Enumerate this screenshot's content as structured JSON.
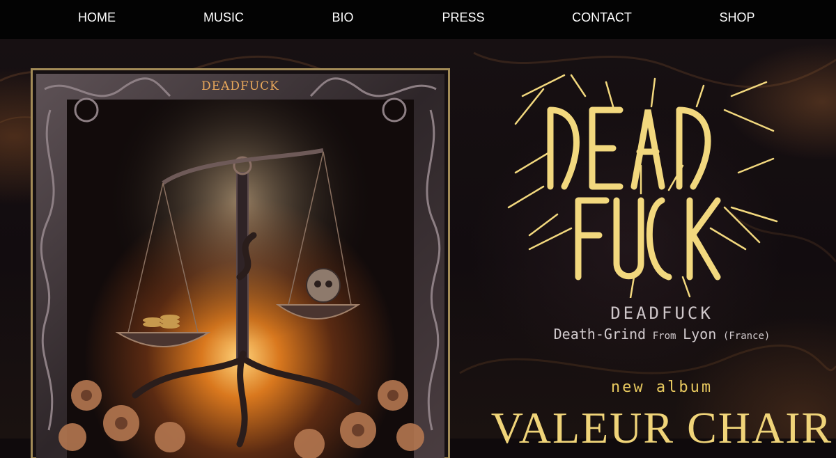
{
  "nav": {
    "items": [
      {
        "label": "HOME"
      },
      {
        "label": "MUSIC"
      },
      {
        "label": "BIO"
      },
      {
        "label": "PRESS"
      },
      {
        "label": "CONTACT"
      },
      {
        "label": "SHOP"
      }
    ]
  },
  "cover": {
    "title": "DEADFUCK",
    "artwork": "scales-of-justice-with-coins-and-skull-amid-roots-and-flowers"
  },
  "hero": {
    "logo": "deadfuck-death-metal-logo",
    "band_name": "DEADFUCK",
    "genre": "Death-Grind",
    "from_word": "From",
    "city": "Lyon",
    "country": "(France)",
    "new_album_label": "new album",
    "album_title": "VALEUR CHAIR"
  },
  "colors": {
    "nav_bg": "#030303",
    "gold": "#f0d479",
    "cover_title": "#e9a85b",
    "text_light": "#d2cbce"
  }
}
